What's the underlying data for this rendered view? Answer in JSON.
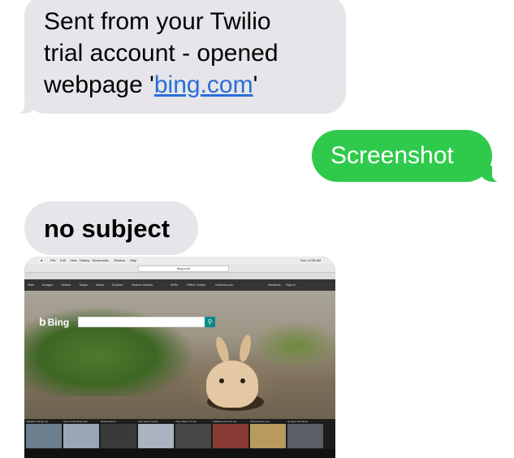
{
  "messages": {
    "msg1": {
      "line1": "Sent from your Twilio",
      "line2": "trial account - opened",
      "line3_prefix": "webpage '",
      "link": "bing.com",
      "line3_suffix": "'"
    },
    "msg2": {
      "text": "Screenshot"
    },
    "msg3": {
      "text": "no subject"
    }
  },
  "attachment": {
    "menubar": [
      "File",
      "Edit",
      "View",
      "History",
      "Bookmarks",
      "Window",
      "Help"
    ],
    "clock": "Sun 12:05 AM",
    "url": "bing.com",
    "search_logo": "Bing",
    "search_icon": "search-icon",
    "nav_items": [
      "Web",
      "Images",
      "Videos",
      "Maps",
      "News",
      "Explore",
      "Search History",
      "MSN",
      "Office Online",
      "Outlook.com"
    ],
    "nav_right": [
      "Rewards",
      "Sign in"
    ],
    "carousel_captions": [
      "Valuable change out",
      "How Tomlin Responds",
      "#FastAndFirst",
      "How women arrive",
      "Chip Warner Trump",
      "Clarkson and new one",
      "2016 election race",
      "Hungry? Get ideas"
    ]
  },
  "colors": {
    "incoming_bubble": "#e5e5ea",
    "outgoing_bubble": "#2fca4b",
    "link": "#2a6ed8"
  }
}
